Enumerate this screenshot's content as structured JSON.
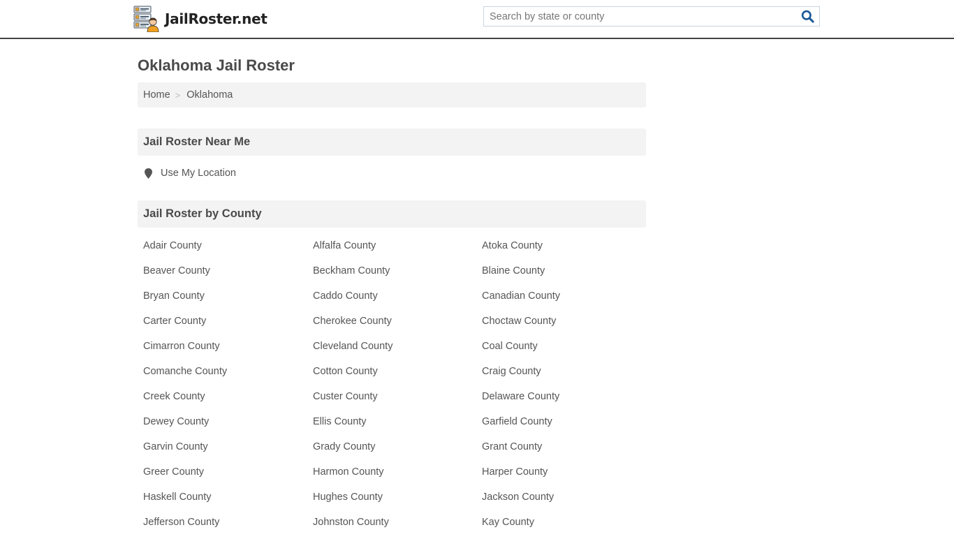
{
  "header": {
    "logo_text": "JailRoster.net",
    "logo_icon": "roster-list-person-icon",
    "search": {
      "placeholder": "Search by state or county",
      "value": "",
      "icon": "search-icon",
      "icon_color": "#1a5a96"
    }
  },
  "page": {
    "title": "Oklahoma Jail Roster",
    "breadcrumb": [
      {
        "label": "Home"
      },
      {
        "label": "Oklahoma"
      }
    ],
    "breadcrumb_separator": ">"
  },
  "near_me": {
    "heading": "Jail Roster Near Me",
    "use_location_label": "Use My Location",
    "icon": "map-marker-icon"
  },
  "by_county": {
    "heading": "Jail Roster by County",
    "counties": [
      "Adair County",
      "Alfalfa County",
      "Atoka County",
      "Beaver County",
      "Beckham County",
      "Blaine County",
      "Bryan County",
      "Caddo County",
      "Canadian County",
      "Carter County",
      "Cherokee County",
      "Choctaw County",
      "Cimarron County",
      "Cleveland County",
      "Coal County",
      "Comanche County",
      "Cotton County",
      "Craig County",
      "Creek County",
      "Custer County",
      "Delaware County",
      "Dewey County",
      "Ellis County",
      "Garfield County",
      "Garvin County",
      "Grady County",
      "Grant County",
      "Greer County",
      "Harmon County",
      "Harper County",
      "Haskell County",
      "Hughes County",
      "Jackson County",
      "Jefferson County",
      "Johnston County",
      "Kay County"
    ]
  }
}
